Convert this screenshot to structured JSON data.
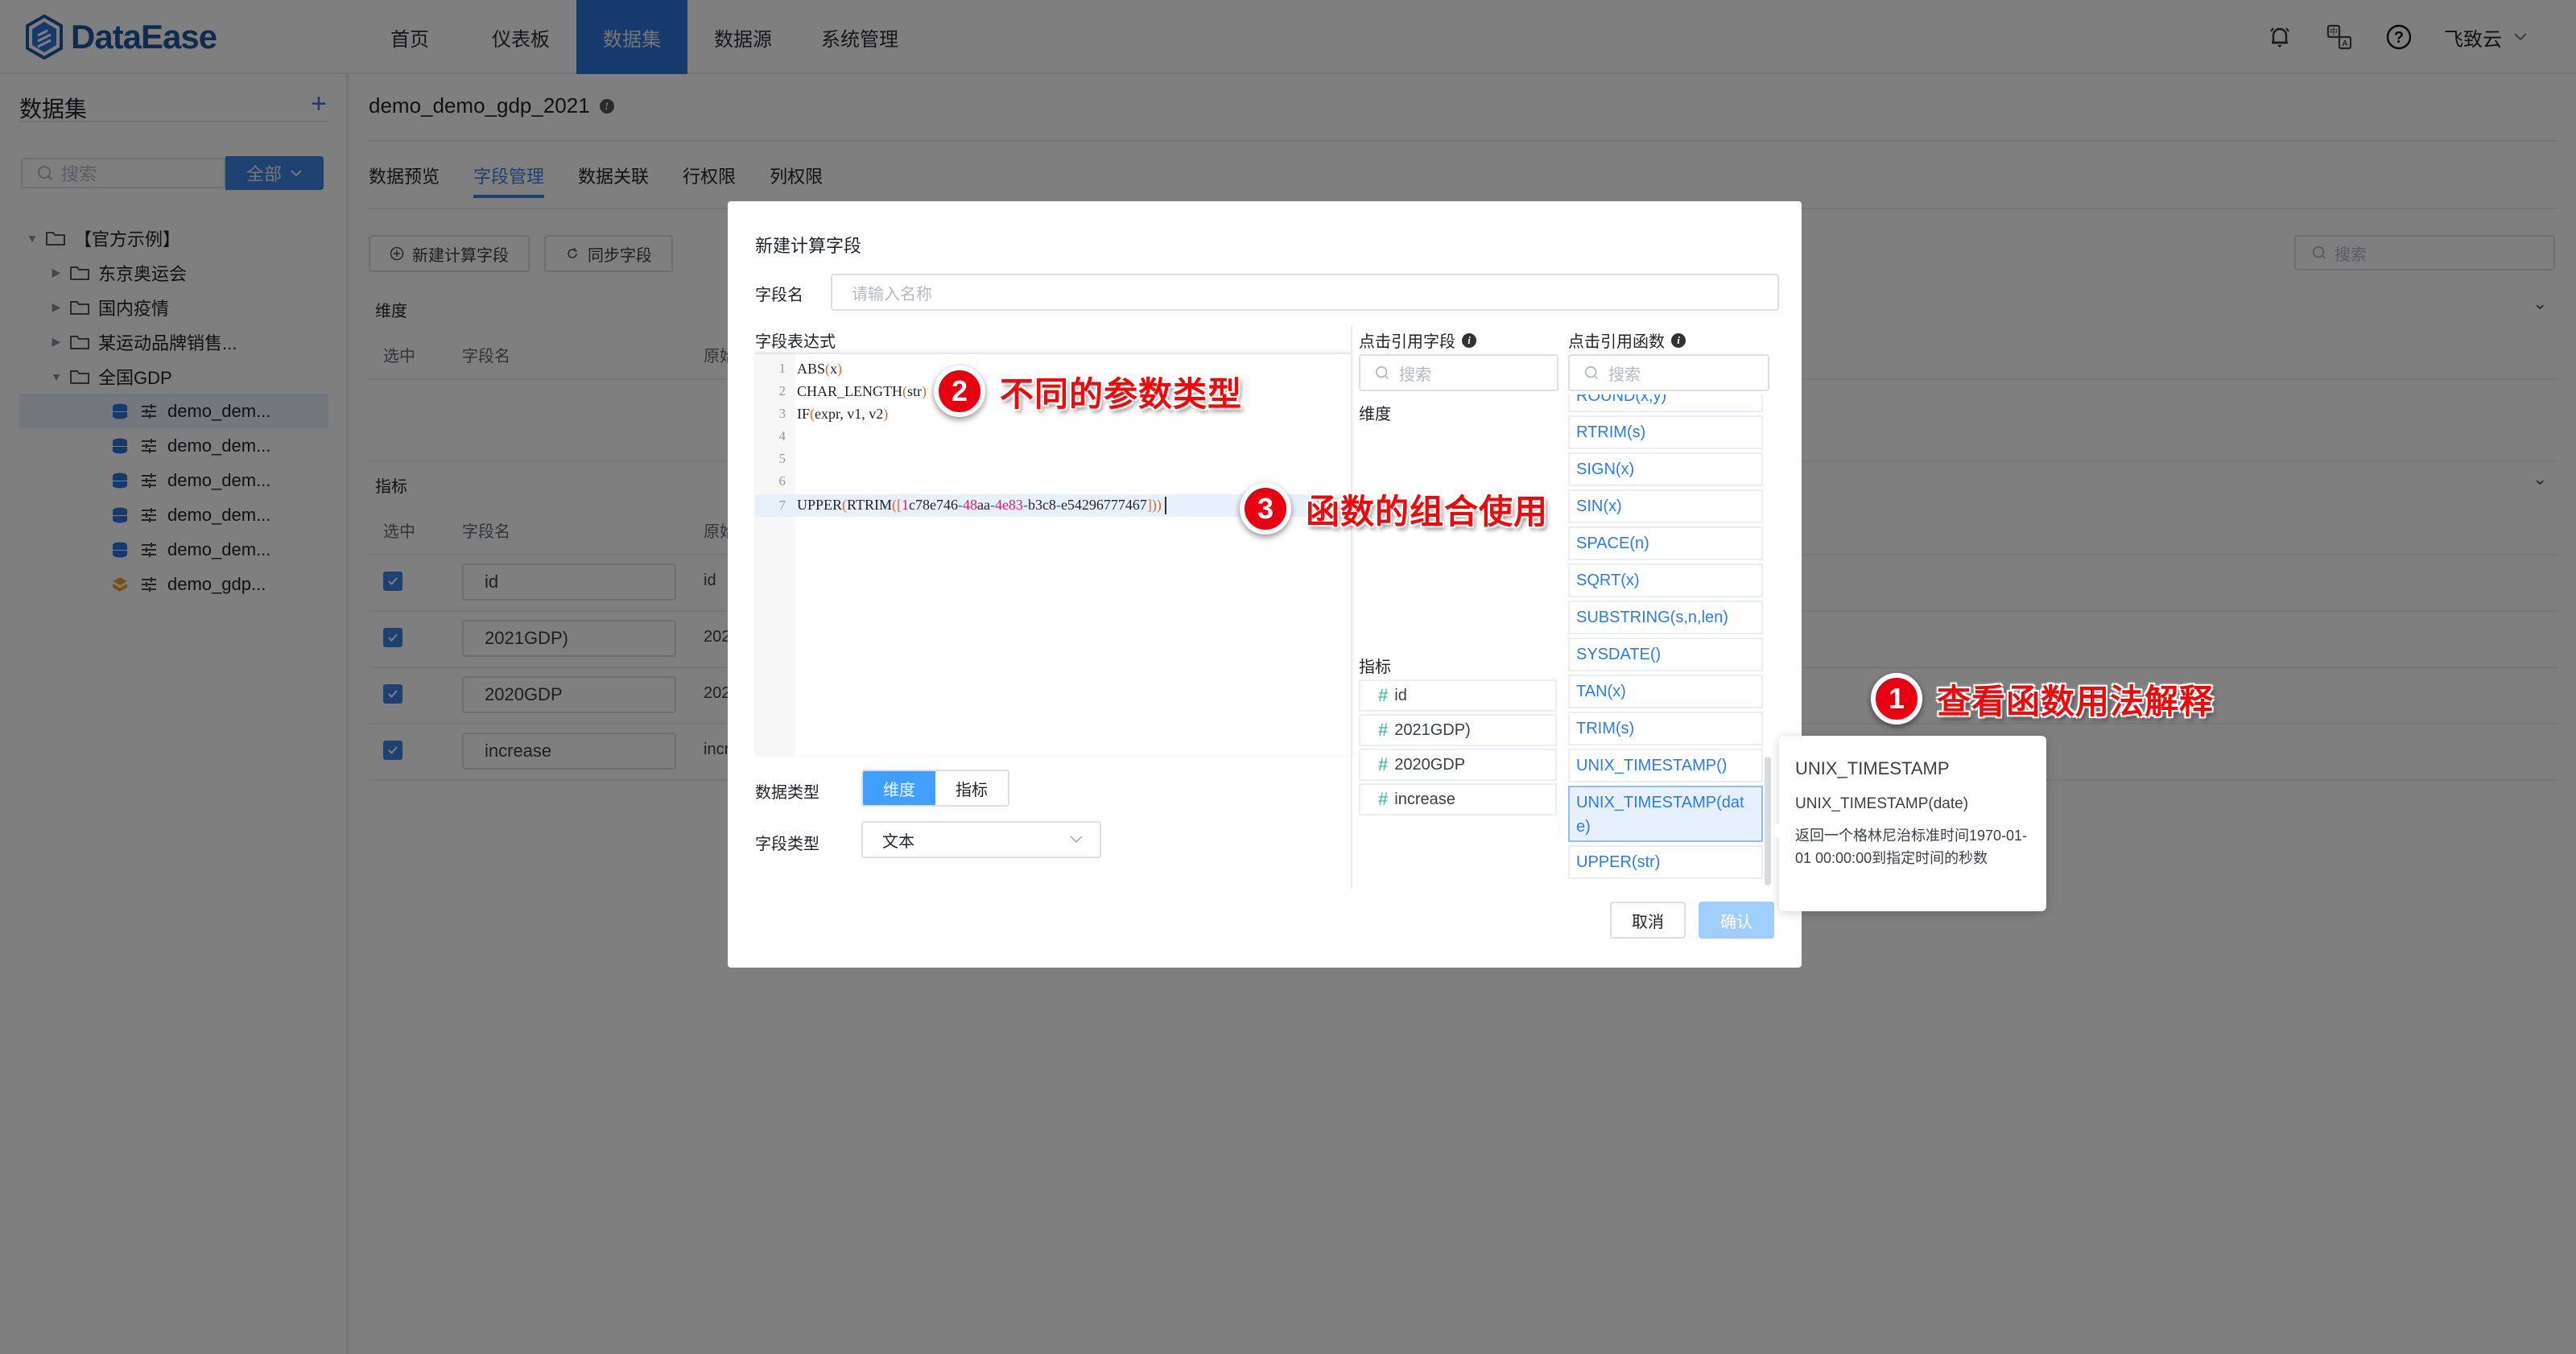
{
  "app": {
    "brand": "DataEase",
    "accent_color": "#2f74d8",
    "nav": [
      {
        "label": "首页",
        "active": false
      },
      {
        "label": "仪表板",
        "active": false
      },
      {
        "label": "数据集",
        "active": true
      },
      {
        "label": "数据源",
        "active": false
      },
      {
        "label": "系统管理",
        "active": false
      }
    ],
    "top_icons": [
      "bell-icon",
      "translate-icon",
      "help-icon"
    ],
    "user": "飞致云"
  },
  "sidebar": {
    "title": "数据集",
    "add_icon": "plus-icon",
    "search_placeholder": "搜索",
    "filter_label": "全部",
    "tree": [
      {
        "level": 0,
        "type": "folder",
        "expanded": true,
        "label": "【官方示例】"
      },
      {
        "level": 1,
        "type": "folder",
        "expanded": false,
        "label": "东京奥运会"
      },
      {
        "level": 1,
        "type": "folder",
        "expanded": false,
        "label": "国内疫情"
      },
      {
        "level": 1,
        "type": "folder",
        "expanded": false,
        "label": "某运动品牌销售..."
      },
      {
        "level": 1,
        "type": "folder",
        "expanded": true,
        "label": "全国GDP"
      },
      {
        "level": 2,
        "type": "db",
        "label": "demo_dem...",
        "selected": true
      },
      {
        "level": 2,
        "type": "db",
        "label": "demo_dem..."
      },
      {
        "level": 2,
        "type": "db",
        "label": "demo_dem..."
      },
      {
        "level": 2,
        "type": "db",
        "label": "demo_dem..."
      },
      {
        "level": 2,
        "type": "db",
        "label": "demo_dem..."
      },
      {
        "level": 2,
        "type": "custom",
        "label": "demo_gdp..."
      }
    ]
  },
  "main": {
    "dataset_title": "demo_demo_gdp_2021",
    "tabs": [
      {
        "label": "数据预览",
        "active": false
      },
      {
        "label": "字段管理",
        "active": true
      },
      {
        "label": "数据关联",
        "active": false
      },
      {
        "label": "行权限",
        "active": false
      },
      {
        "label": "列权限",
        "active": false
      }
    ],
    "new_calc_field_label": "新建计算字段",
    "sync_field_label": "同步字段",
    "search_placeholder": "搜索",
    "dimension_section": "维度",
    "measure_section": "指标",
    "columns": {
      "selected": "选中",
      "field_name": "字段名",
      "origin": "原始"
    },
    "measure_rows": [
      {
        "checked": true,
        "name": "id",
        "origin": "id"
      },
      {
        "checked": true,
        "name": "2021GDP)",
        "origin": "202"
      },
      {
        "checked": true,
        "name": "2020GDP",
        "origin": "202"
      },
      {
        "checked": true,
        "name": "increase",
        "origin": "incr"
      }
    ]
  },
  "dialog": {
    "title": "新建计算字段",
    "field_name_label": "字段名",
    "field_name_placeholder": "请输入名称",
    "expression_label": "字段表达式",
    "code_lines": [
      {
        "n": "1",
        "text": "ABS(x)"
      },
      {
        "n": "2",
        "text": "CHAR_LENGTH(str)"
      },
      {
        "n": "3",
        "text": "IF(expr,v1,v2)"
      },
      {
        "n": "4",
        "text": ""
      },
      {
        "n": "5",
        "text": ""
      },
      {
        "n": "6",
        "text": ""
      },
      {
        "n": "7",
        "text": "UPPER(RTRIM([1c78e746-48aa-4e83-b3c8-e54296777467]))"
      }
    ],
    "field_ref_title": "点击引用字段",
    "func_ref_title": "点击引用函数",
    "search_placeholder": "搜索",
    "dimension_label": "维度",
    "measure_label": "指标",
    "measure_fields": [
      "id",
      "2021GDP)",
      "2020GDP",
      "increase"
    ],
    "functions": [
      "ROUND(x,y)",
      "RTRIM(s)",
      "SIGN(x)",
      "SIN(x)",
      "SPACE(n)",
      "SQRT(x)",
      "SUBSTRING(s,n,len)",
      "SYSDATE()",
      "TAN(x)",
      "TRIM(s)",
      "UNIX_TIMESTAMP()",
      "UNIX_TIMESTAMP(date)",
      "UPPER(str)"
    ],
    "highlighted_function": "UNIX_TIMESTAMP(date)",
    "data_type_label": "数据类型",
    "data_type_options": [
      "维度",
      "指标"
    ],
    "data_type_selected": "维度",
    "field_type_label": "字段类型",
    "field_type_value": "文本",
    "cancel_label": "取消",
    "confirm_label": "确认"
  },
  "popover": {
    "title": "UNIX_TIMESTAMP",
    "signature": "UNIX_TIMESTAMP(date)",
    "description": "返回一个格林尼治标准时间1970-01-01 00:00:00到指定时间的秒数"
  },
  "annotations": [
    {
      "number": "1",
      "text": "查看函数用法解释"
    },
    {
      "number": "2",
      "text": "不同的参数类型"
    },
    {
      "number": "3",
      "text": "函数的组合使用"
    }
  ]
}
